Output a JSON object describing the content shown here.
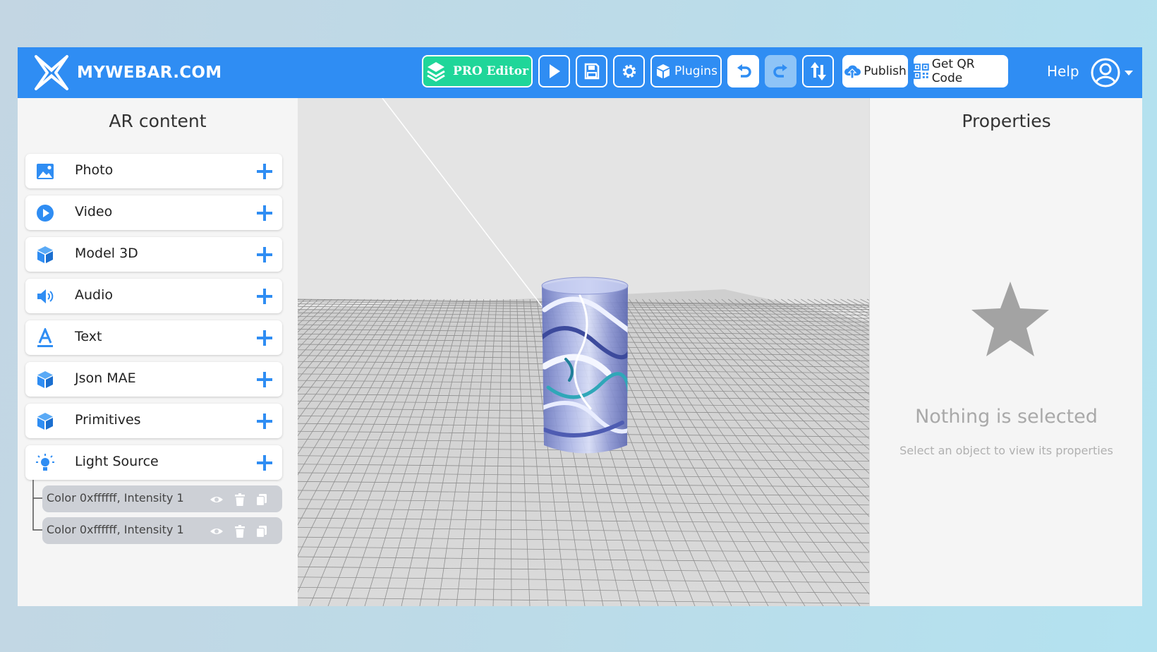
{
  "topbar": {
    "logo_text": "MYWEBAR.COM",
    "pro_editor": "PRO Editor",
    "plugins": "Plugins",
    "publish": "Publish",
    "get_qr": "Get QR Code",
    "help": "Help",
    "icons": [
      "layers-icon",
      "play-icon",
      "save-icon",
      "gear-icon",
      "plugins-icon",
      "undo-icon",
      "redo-icon",
      "sort-arrows-icon",
      "cloud-upload-icon",
      "qr-code-icon",
      "user-icon",
      "caret-down-icon"
    ],
    "colors": {
      "bar": "#2f8df3",
      "pro": "#1fd699"
    }
  },
  "left_panel": {
    "title": "AR content",
    "items": [
      {
        "label": "Photo",
        "icon": "photo-icon"
      },
      {
        "label": "Video",
        "icon": "video-play-icon"
      },
      {
        "label": "Model 3D",
        "icon": "cube-icon"
      },
      {
        "label": "Audio",
        "icon": "speaker-icon"
      },
      {
        "label": "Text",
        "icon": "text-a-icon"
      },
      {
        "label": "Json MAE",
        "icon": "cube-icon"
      },
      {
        "label": "Primitives",
        "icon": "cube-icon"
      },
      {
        "label": "Light Source",
        "icon": "lightbulb-icon"
      }
    ],
    "light_children": [
      {
        "label": "Color 0xffffff, Intensity 1"
      },
      {
        "label": "Color 0xffffff, Intensity 1"
      }
    ]
  },
  "right_panel": {
    "title": "Properties",
    "empty_title": "Nothing is selected",
    "empty_hint": "Select an object to view its properties"
  }
}
